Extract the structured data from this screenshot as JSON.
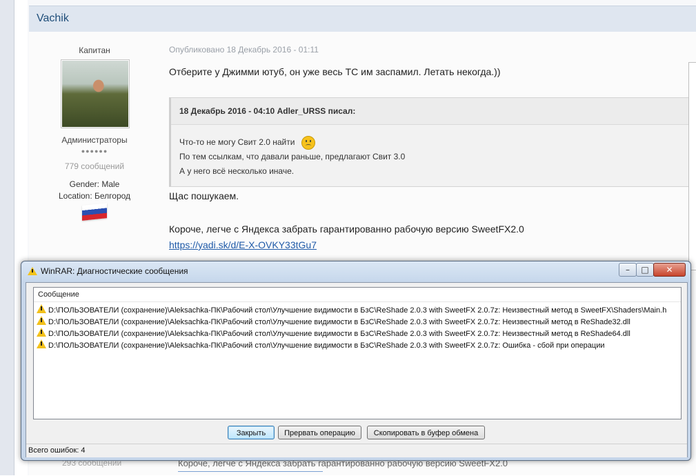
{
  "forum": {
    "author": "Vachik",
    "rank": "Капитан",
    "group": "Администраторы",
    "pips": "●●●●●●",
    "post_count": "779 сообщений",
    "gender": "Gender: Male",
    "location": "Location: Белгород",
    "post_date": "Опубликовано 18 Декабрь 2016 - 01:11",
    "post_line1": "Отберите у Джимми ютуб, он уже весь ТС им заспамил. Летать некогда.))",
    "quote": {
      "header": "18 Декабрь 2016 - 04:10 Adler_URSS писал:",
      "line1": "Что-то не могу Свит 2.0 найти",
      "line2": "По тем ссылкам, что давали раньше, предлагают Свит 3.0",
      "line3": "А у него всё несколько иначе."
    },
    "post_line2": "Щас пошукаем.",
    "post_line3": "Короче, легче с Яндекса забрать гарантированно рабочую версию SweetFX2.0",
    "post_link": "https://yadi.sk/d/E-X-OVKY33tGu7",
    "bottom_posts": "293 сообщении",
    "bottom_text": "Короче, легче с Яндекса забрать гарантированно рабочую версию SweetFX2.0"
  },
  "dialog": {
    "title": "WinRAR: Диагностические сообщения",
    "controls": {
      "minimize": "–",
      "maximize": "□",
      "close": "✕"
    },
    "column_header": "Сообщение",
    "rows": [
      "D:\\ПОЛЬЗОВАТЕЛИ  (сохранение)\\Aleksachka-ПК\\Рабочий стол\\Улучшение видимости в БзС\\ReShade 2.0.3 with SweetFX 2.0.7z: Неизвестный метод в SweetFX\\Shaders\\Main.h",
      "D:\\ПОЛЬЗОВАТЕЛИ  (сохранение)\\Aleksachka-ПК\\Рабочий стол\\Улучшение видимости в БзС\\ReShade 2.0.3 with SweetFX 2.0.7z: Неизвестный метод в ReShade32.dll",
      "D:\\ПОЛЬЗОВАТЕЛИ  (сохранение)\\Aleksachka-ПК\\Рабочий стол\\Улучшение видимости в БзС\\ReShade 2.0.3 with SweetFX 2.0.7z: Неизвестный метод в ReShade64.dll",
      "D:\\ПОЛЬЗОВАТЕЛИ  (сохранение)\\Aleksachka-ПК\\Рабочий стол\\Улучшение видимости в БзС\\ReShade 2.0.3 with SweetFX 2.0.7z: Ошибка - сбой при операции"
    ],
    "buttons": {
      "close": "Закрыть",
      "abort": "Прервать операцию",
      "copy": "Скопировать в буфер обмена"
    },
    "status": "Всего ошибок: 4"
  }
}
